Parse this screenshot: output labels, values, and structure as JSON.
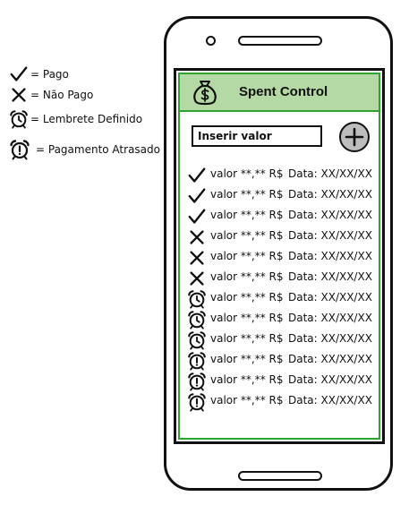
{
  "legend": [
    {
      "icon": "check-icon",
      "label": "= Pago"
    },
    {
      "icon": "x-icon",
      "label": "= Não Pago"
    },
    {
      "icon": "alarm-clock-icon",
      "label": "= Lembrete Definido"
    },
    {
      "icon": "alarm-alert-icon",
      "label": "= Pagamento Atrasado"
    }
  ],
  "app": {
    "title": "Spent Control",
    "logo_icon": "money-bag-icon",
    "input_placeholder": "Inserir valor",
    "add_button_icon": "plus-circle-icon"
  },
  "entries": [
    {
      "status": "pago",
      "icon": "check-icon",
      "value": "valor **,** R$",
      "date": "Data: XX/XX/XX"
    },
    {
      "status": "pago",
      "icon": "check-icon",
      "value": "valor **,** R$",
      "date": "Data: XX/XX/XX"
    },
    {
      "status": "pago",
      "icon": "check-icon",
      "value": "valor **,** R$",
      "date": "Data: XX/XX/XX"
    },
    {
      "status": "nao-pago",
      "icon": "x-icon",
      "value": "valor **,** R$",
      "date": "Data: XX/XX/XX"
    },
    {
      "status": "nao-pago",
      "icon": "x-icon",
      "value": "valor **,** R$",
      "date": "Data: XX/XX/XX"
    },
    {
      "status": "nao-pago",
      "icon": "x-icon",
      "value": "valor **,** R$",
      "date": "Data: XX/XX/XX"
    },
    {
      "status": "lembrete",
      "icon": "alarm-clock-icon",
      "value": "valor **,** R$",
      "date": "Data: XX/XX/XX"
    },
    {
      "status": "lembrete",
      "icon": "alarm-clock-icon",
      "value": "valor **,** R$",
      "date": "Data: XX/XX/XX"
    },
    {
      "status": "lembrete",
      "icon": "alarm-clock-icon",
      "value": "valor **,** R$",
      "date": "Data: XX/XX/XX"
    },
    {
      "status": "atrasado",
      "icon": "alarm-alert-icon",
      "value": "valor **,** R$",
      "date": "Data: XX/XX/XX"
    },
    {
      "status": "atrasado",
      "icon": "alarm-alert-icon",
      "value": "valor **,** R$",
      "date": "Data: XX/XX/XX"
    },
    {
      "status": "atrasado",
      "icon": "alarm-alert-icon",
      "value": "valor **,** R$",
      "date": "Data: XX/XX/XX"
    }
  ],
  "colors": {
    "header_bg": "#b5d9a5",
    "screen_border": "#2fa52f",
    "add_button_bg": "#bdbdbd"
  }
}
